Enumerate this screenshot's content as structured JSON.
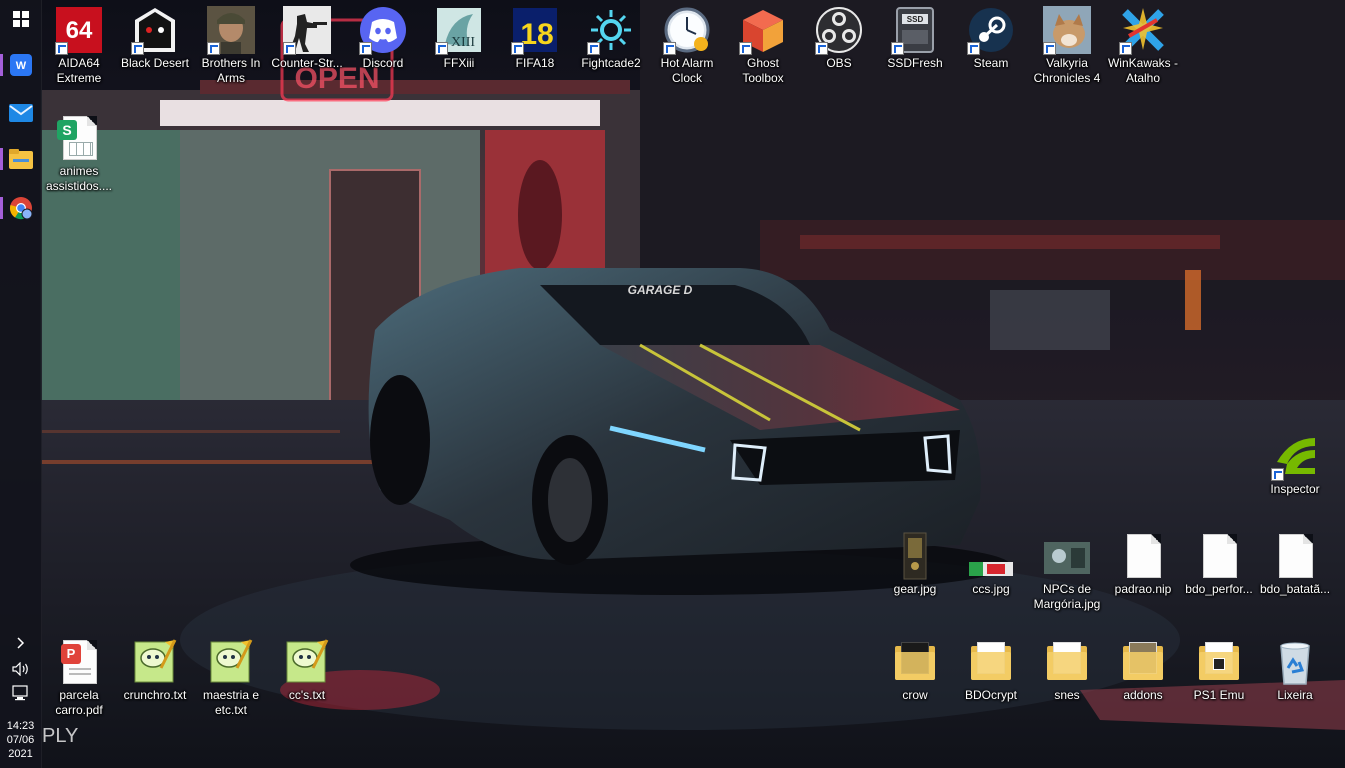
{
  "taskbar": {
    "time": "14:23",
    "date": "07/06",
    "year": "2021",
    "icons": [
      "windows-start-icon",
      "wps-office-icon",
      "mail-icon",
      "file-explorer-icon",
      "chrome-icon"
    ]
  },
  "wallpaper": {
    "sign_text": "OPEN",
    "car_badge": "GARAGE D",
    "corner_text": "PLY"
  },
  "desktop": {
    "top_row": [
      {
        "label": "AIDA64 Extreme",
        "icon": "aida64-icon"
      },
      {
        "label": "Black Desert",
        "icon": "black-desert-icon"
      },
      {
        "label": "Brothers In Arms",
        "icon": "brothers-in-arms-icon"
      },
      {
        "label": "Counter-Str...",
        "icon": "counter-strike-icon"
      },
      {
        "label": "Discord",
        "icon": "discord-icon"
      },
      {
        "label": "FFXiii",
        "icon": "ffxiii-icon"
      },
      {
        "label": "FIFA18",
        "icon": "fifa18-icon"
      },
      {
        "label": "Fightcade2",
        "icon": "fightcade-icon"
      },
      {
        "label": "Hot Alarm Clock",
        "icon": "alarm-clock-icon"
      },
      {
        "label": "Ghost Toolbox",
        "icon": "ghost-toolbox-icon"
      },
      {
        "label": "OBS",
        "icon": "obs-icon"
      },
      {
        "label": "SSDFresh",
        "icon": "ssd-icon"
      },
      {
        "label": "Steam",
        "icon": "steam-icon"
      },
      {
        "label": "Valkyria Chronicles 4",
        "icon": "valkyria-icon"
      },
      {
        "label": "WinKawaks - Atalho",
        "icon": "winkawaks-icon"
      }
    ],
    "animes": {
      "label": "animes assistidos....",
      "icon": "spreadsheet-icon"
    },
    "inspector": {
      "label": "Inspector",
      "icon": "nvidia-icon"
    },
    "right_row1": [
      {
        "label": "gear.jpg",
        "icon": "image-file-icon"
      },
      {
        "label": "ccs.jpg",
        "icon": "image-file-icon"
      },
      {
        "label": "NPCs de Margória.jpg",
        "icon": "image-file-icon"
      },
      {
        "label": "padrao.nip",
        "icon": "blank-file-icon"
      },
      {
        "label": "bdo_perfor...",
        "icon": "blank-file-icon"
      },
      {
        "label": "bdo_batatã...",
        "icon": "blank-file-icon"
      }
    ],
    "bottom_left": [
      {
        "label": "parcela carro.pdf",
        "icon": "pdf-file-icon"
      },
      {
        "label": "crunchro.txt",
        "icon": "notepad-file-icon"
      },
      {
        "label": "maestria e etc.txt",
        "icon": "notepad-file-icon"
      },
      {
        "label": "cc's.txt",
        "icon": "notepad-file-icon"
      }
    ],
    "bottom_right": [
      {
        "label": "crow",
        "icon": "folder-icon"
      },
      {
        "label": "BDOcrypt",
        "icon": "folder-icon"
      },
      {
        "label": "snes",
        "icon": "folder-icon"
      },
      {
        "label": "addons",
        "icon": "folder-icon"
      },
      {
        "label": "PS1 Emu",
        "icon": "folder-icon"
      },
      {
        "label": "Lixeira",
        "icon": "recycle-bin-icon"
      }
    ]
  }
}
